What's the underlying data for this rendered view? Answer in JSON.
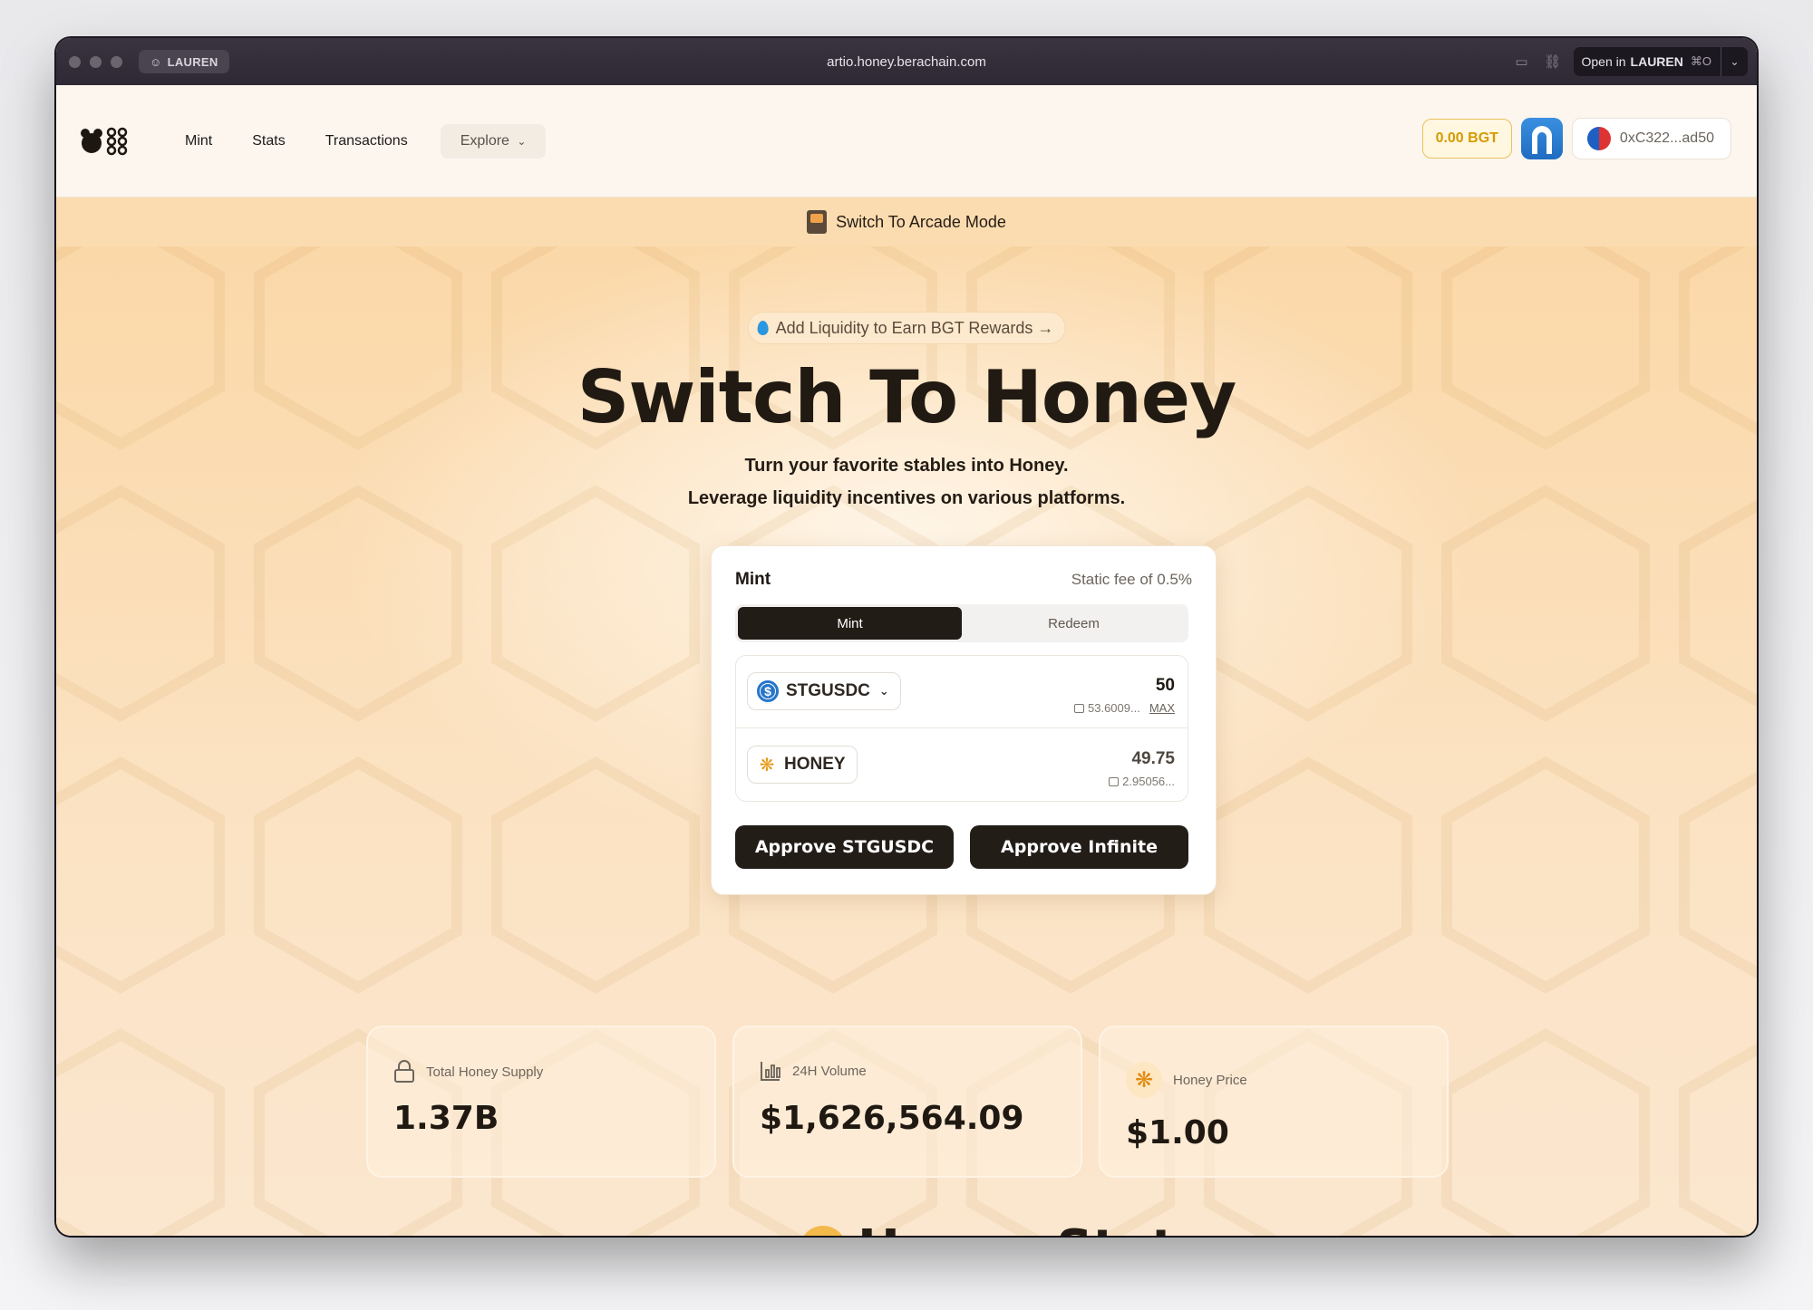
{
  "browser": {
    "profile": "LAUREN",
    "url": "artio.honey.berachain.com",
    "open_in_prefix": "Open in",
    "open_in_target": "LAUREN",
    "open_in_shortcut": "⌘O"
  },
  "nav": {
    "items": [
      {
        "label": "Mint"
      },
      {
        "label": "Stats"
      },
      {
        "label": "Transactions"
      }
    ],
    "explore_label": "Explore",
    "bgt_balance": "0.00 BGT",
    "account": "0xC322...ad50"
  },
  "arcade": {
    "label": "Switch To Arcade Mode"
  },
  "hero": {
    "pill": "Add Liquidity to Earn BGT Rewards →",
    "title": "Switch To Honey",
    "subtitle_line1": "Turn your favorite stables into Honey.",
    "subtitle_line2": "Leverage liquidity incentives on various platforms."
  },
  "card": {
    "title": "Mint",
    "fee": "Static fee of 0.5%",
    "tabs": [
      {
        "label": "Mint",
        "active": true
      },
      {
        "label": "Redeem",
        "active": false
      }
    ],
    "from": {
      "token": "STGUSDC",
      "amount": "50",
      "balance": "53.6009...",
      "max_label": "MAX"
    },
    "to": {
      "token": "HONEY",
      "amount": "49.75",
      "balance": "2.95056..."
    },
    "approve_label": "Approve STGUSDC",
    "approve_infinite_label": "Approve Infinite"
  },
  "stats": [
    {
      "label": "Total Honey Supply",
      "value": "1.37B",
      "icon": "lock-icon"
    },
    {
      "label": "24H Volume",
      "value": "$1,626,564.09",
      "icon": "bar-chart-icon"
    },
    {
      "label": "Honey Price",
      "value": "$1.00",
      "icon": "honey-icon"
    }
  ],
  "peek_title": "Honey Stats",
  "colors": {
    "accent_dark": "#231d18",
    "bgt_gold": "#d59a00",
    "background_honey": "#fbe3c4"
  }
}
